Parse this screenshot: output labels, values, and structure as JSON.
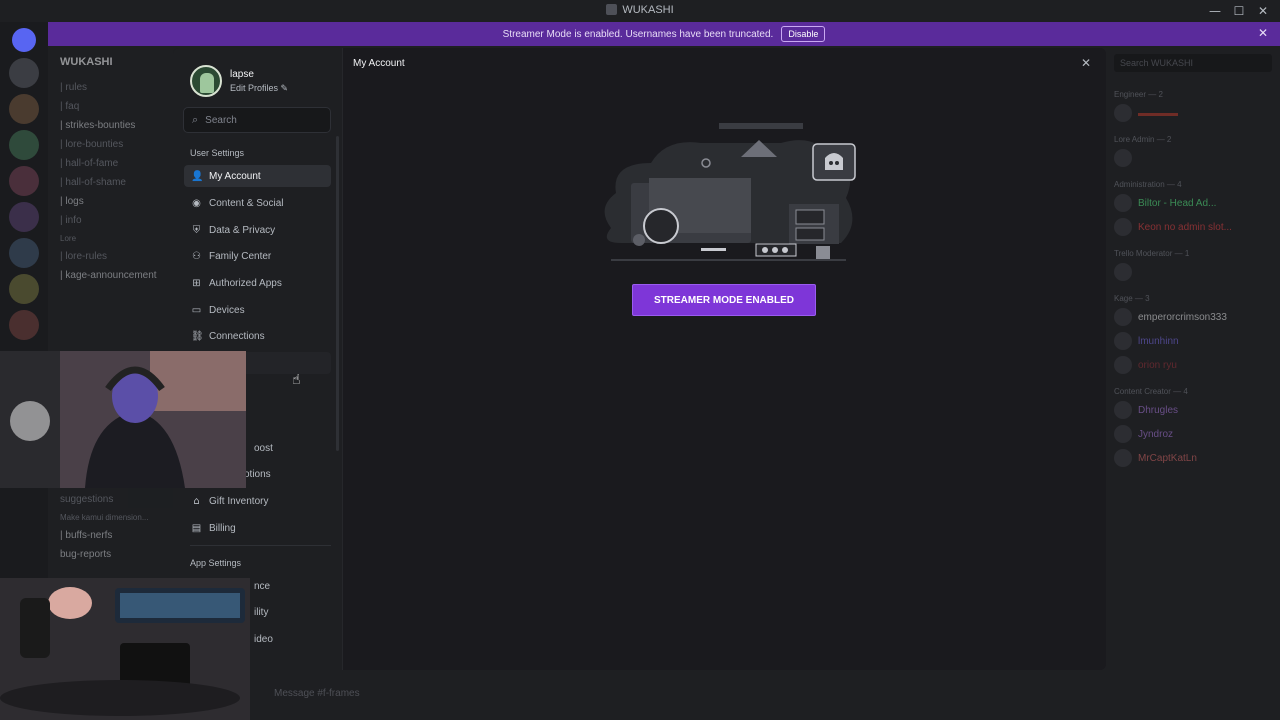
{
  "window": {
    "title": "WUKASHI",
    "controls": [
      "—",
      "☐",
      "✕"
    ]
  },
  "banner": {
    "text": "Streamer Mode is enabled. Usernames have been truncated.",
    "disable_label": "Disable"
  },
  "channels": {
    "server_name": "WUKASHI",
    "items": [
      "| rules",
      "| faq",
      "| strikes-bounties",
      "| lore-bounties",
      "| hall-of-fame",
      "| hall-of-shame",
      "| logs",
      "| info",
      "Lore",
      "| lore-rules",
      "| kage-announcement"
    ],
    "items_lower": [
      "suggestions",
      "Make kamui dimension...",
      "| buffs-nerfs",
      "bug-reports"
    ]
  },
  "members": {
    "search_placeholder": "Search WUKASHI",
    "roles": [
      "Engineer — 2",
      "Lore Admin — 2",
      "Administration — 4",
      "Trello Moderator — 1",
      "Kage — 3",
      "Content Creator — 4"
    ],
    "names": [
      "Biltor - Head Ad...",
      "Keon no admin slot...",
      "emperorcrimson333",
      "lmunhinn",
      "orion ryu",
      "Dhrugles",
      "Jyndroz",
      "MrCaptKatLn"
    ]
  },
  "message_bar": {
    "placeholder": "Message #f-frames"
  },
  "modal": {
    "profile": {
      "name": "lapse",
      "edit_label": "Edit Profiles"
    },
    "search_placeholder": "Search",
    "user_settings_label": "User Settings",
    "nav": [
      {
        "label": "My Account",
        "icon": "person-icon",
        "glyph": "👤"
      },
      {
        "label": "Content & Social",
        "icon": "content-icon",
        "glyph": "◉"
      },
      {
        "label": "Data & Privacy",
        "icon": "shield-icon",
        "glyph": "⛨"
      },
      {
        "label": "Family Center",
        "icon": "family-icon",
        "glyph": "⚇"
      },
      {
        "label": "Authorized Apps",
        "icon": "apps-icon",
        "glyph": "⊞"
      },
      {
        "label": "Devices",
        "icon": "devices-icon",
        "glyph": "▭"
      },
      {
        "label": "Connections",
        "icon": "link-icon",
        "glyph": "⛓"
      }
    ],
    "nav_lower": [
      {
        "label": "oost",
        "icon": "boost-icon",
        "glyph": ""
      },
      {
        "label": "otions",
        "icon": "subscriptions-icon",
        "glyph": ""
      },
      {
        "label": "Gift Inventory",
        "icon": "gift-icon",
        "glyph": "🎁"
      },
      {
        "label": "Billing",
        "icon": "billing-icon",
        "glyph": "▤"
      }
    ],
    "app_settings_label": "App Settings",
    "nav_app": [
      {
        "label": "nce"
      },
      {
        "label": "ility"
      },
      {
        "label": "ideo"
      }
    ],
    "main_title": "My Account",
    "streamer_button": "STREAMER MODE ENABLED"
  }
}
